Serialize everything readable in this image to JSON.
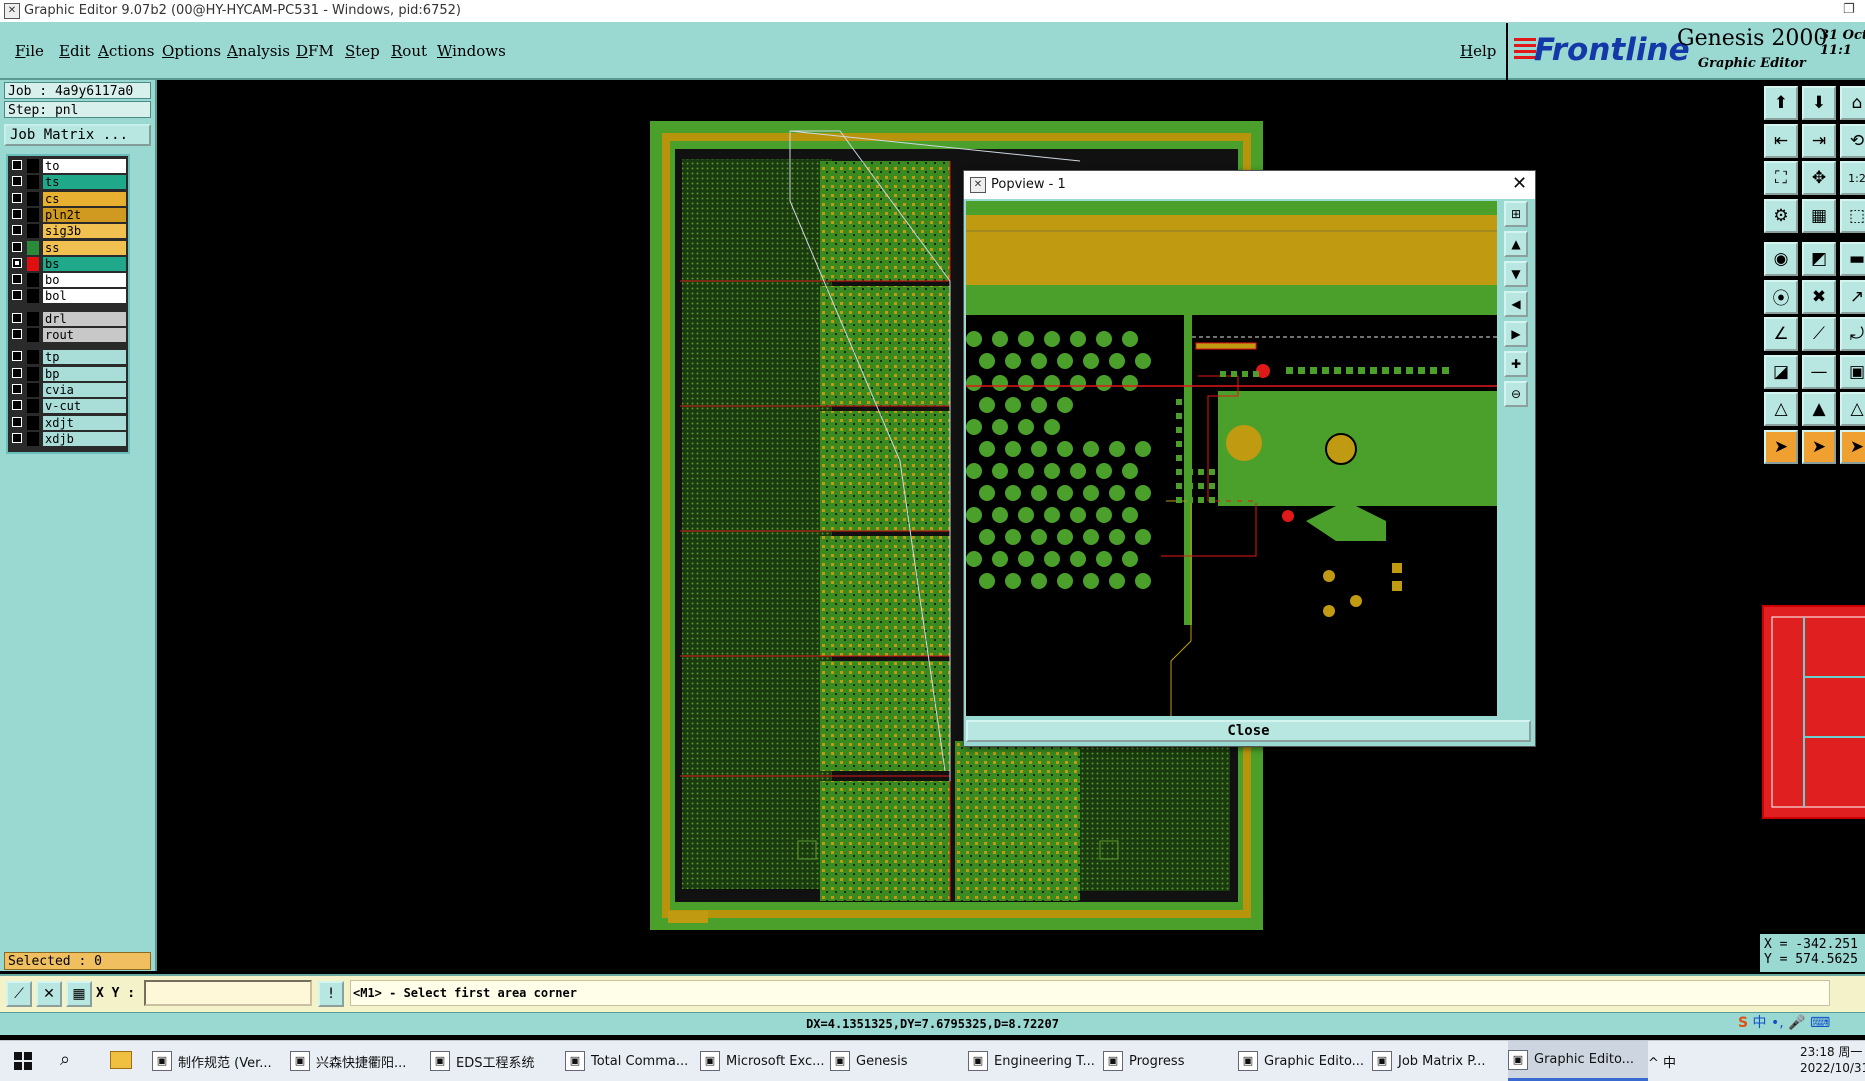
{
  "window": {
    "title": "Graphic Editor 9.07b2 (00@HY-HYCAM-PC531 - Windows, pid:6752)"
  },
  "menu": [
    "File",
    "Edit",
    "Actions",
    "Options",
    "Analysis",
    "DFM",
    "Step",
    "Rout",
    "Windows",
    "Help"
  ],
  "brand": {
    "logo": "Frontline",
    "product": "Genesis 2000",
    "subtitle": "Graphic Editor",
    "date_line1": "31 Oct",
    "date_line2": "11:1"
  },
  "left_panel": {
    "job": "Job : 4a9y6117a0",
    "step": "Step: pnl",
    "job_matrix": "Job Matrix ...",
    "selected": "Selected : 0",
    "layers": [
      {
        "name": "to",
        "bg": "#ffffff",
        "swatch": "#000000",
        "checked": false
      },
      {
        "name": "ts",
        "bg": "#1fa88a",
        "swatch": "#000000",
        "checked": false
      },
      {
        "name": "cs",
        "bg": "#e8b030",
        "swatch": "#000000",
        "checked": false
      },
      {
        "name": "pln2t",
        "bg": "#d09a20",
        "swatch": "#000000",
        "checked": false
      },
      {
        "name": "sig3b",
        "bg": "#f0c050",
        "swatch": "#000000",
        "checked": false
      },
      {
        "name": "ss",
        "bg": "#f0c050",
        "swatch": "#2a8a3a",
        "checked": false
      },
      {
        "name": "bs",
        "bg": "#1fa88a",
        "swatch": "#e01010",
        "checked": true
      },
      {
        "name": "bo",
        "bg": "#ffffff",
        "swatch": "#000000",
        "checked": false
      },
      {
        "name": "bol",
        "bg": "#ffffff",
        "swatch": "#000000",
        "checked": false
      },
      {
        "name": "drl",
        "bg": "#c8c8c8",
        "swatch": "#000000",
        "checked": false
      },
      {
        "name": "rout",
        "bg": "#c8c8c8",
        "swatch": "#000000",
        "checked": false
      },
      {
        "name": "tp",
        "bg": "#a8ddd8",
        "swatch": "#000000",
        "checked": false
      },
      {
        "name": "bp",
        "bg": "#a8ddd8",
        "swatch": "#000000",
        "checked": false
      },
      {
        "name": "cvia",
        "bg": "#a8ddd8",
        "swatch": "#000000",
        "checked": false
      },
      {
        "name": "v-cut",
        "bg": "#a8ddd8",
        "swatch": "#000000",
        "checked": false
      },
      {
        "name": "xdjt",
        "bg": "#a8ddd8",
        "swatch": "#000000",
        "checked": false
      },
      {
        "name": "xdjb",
        "bg": "#a8ddd8",
        "swatch": "#000000",
        "checked": false
      }
    ]
  },
  "popup": {
    "title": "Popview - 1",
    "close_label": "Close"
  },
  "command_bar": {
    "xy_label": "X Y :",
    "xy_value": "",
    "prompt": "<M1> - Select first area corner"
  },
  "status": "DX=4.1351325,DY=7.6795325,D=8.72207",
  "coords": {
    "x": "X = -342.251",
    "y": "Y = 574.5625"
  },
  "ime": "中 •, 🎤 ⌨",
  "taskbar": {
    "items": [
      {
        "label": "制作规范 (Ver...",
        "icon": "doc-icon"
      },
      {
        "label": "兴森快捷衢阳...",
        "icon": "app-icon"
      },
      {
        "label": "EDS工程系统",
        "icon": "eds-icon"
      },
      {
        "label": "Total Comma...",
        "icon": "disk-icon"
      },
      {
        "label": "Microsoft Exc...",
        "icon": "excel-icon"
      },
      {
        "label": "Genesis",
        "icon": "genesis-icon"
      },
      {
        "label": "Engineering T...",
        "icon": "window-icon"
      },
      {
        "label": "Progress",
        "icon": "window-icon"
      },
      {
        "label": "Graphic Edito...",
        "icon": "window-icon"
      },
      {
        "label": "Job Matrix P...",
        "icon": "window-icon"
      },
      {
        "label": "Graphic Edito...",
        "icon": "window-icon",
        "active": true
      }
    ],
    "tray": "^ 中",
    "time": "23:18 周一",
    "date": "2022/10/31"
  },
  "colors": {
    "panel": "#9ad8d2",
    "board_green": "#4aa02a",
    "board_gold": "#c09a10",
    "highlight_red": "#e01010"
  }
}
